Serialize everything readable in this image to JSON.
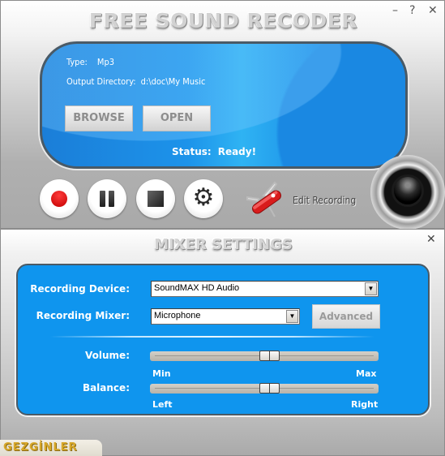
{
  "app": {
    "title": "FREE SOUND RECODER",
    "window_controls": {
      "minimize": "–",
      "help": "?",
      "close": "✕"
    }
  },
  "info": {
    "type_label": "Type:",
    "type_value": "Mp3",
    "output_dir_label": "Output Directory:",
    "output_dir_value": "d:\\doc\\My Music",
    "browse_label": "BROWSE",
    "open_label": "OPEN",
    "status_label": "Status:",
    "status_value": "Ready!"
  },
  "controls": {
    "record_icon": "record-icon",
    "pause_icon": "pause-icon",
    "stop_icon": "stop-icon",
    "settings_icon": "⚙",
    "edit_recording_label": "Edit Recording",
    "edit_icon": "swiss-knife-icon",
    "speaker_icon": "speaker-icon"
  },
  "mixer": {
    "title": "MIXER SETTINGS",
    "close": "✕",
    "recording_device_label": "Recording Device:",
    "recording_device_value": "SoundMAX HD Audio",
    "recording_mixer_label": "Recording Mixer:",
    "recording_mixer_value": "Microphone",
    "dropdown_arrow": "▼",
    "advanced_label": "Advanced",
    "volume_label": "Volume:",
    "volume_value_percent": 52,
    "volume_min_label": "Min",
    "volume_max_label": "Max",
    "balance_label": "Balance:",
    "balance_value_percent": 52,
    "balance_left_label": "Left",
    "balance_right_label": "Right"
  },
  "colors": {
    "panel_blue": "#0f95ee",
    "record_red": "#d40000",
    "watermark_gold": "#d7a72a"
  },
  "watermark": {
    "text": "GEZGİNLER"
  }
}
